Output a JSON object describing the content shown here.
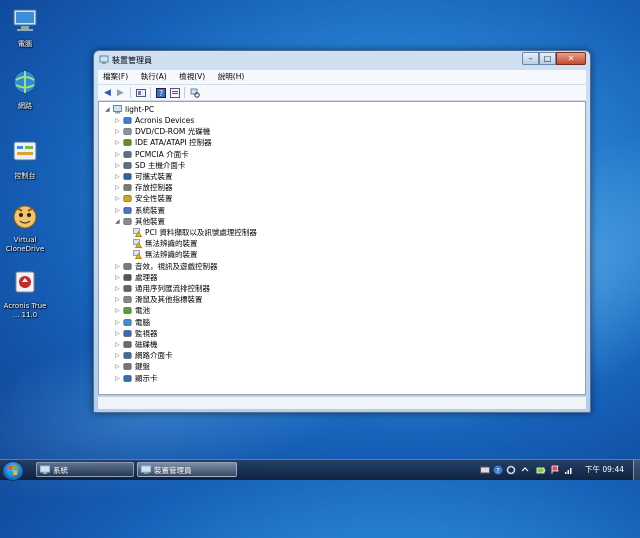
{
  "desktop": {
    "icons": [
      {
        "label": "電腦",
        "icon": "computer-icon"
      },
      {
        "label": "網路",
        "icon": "network-icon"
      },
      {
        "label": "控制台",
        "icon": "control-panel-icon"
      },
      {
        "label": "Virtual CloneDrive",
        "icon": "virtual-clonedrive-icon"
      },
      {
        "label": "Acronis True ... 11.0",
        "icon": "acronis-icon"
      }
    ]
  },
  "window": {
    "title": "裝置管理員",
    "menu": [
      "檔案(F)",
      "執行(A)",
      "檢視(V)",
      "說明(H)"
    ],
    "controls": {
      "minimize": "–",
      "maximize": "□",
      "close": "✕"
    }
  },
  "tree": {
    "root": "light-PC",
    "items": [
      {
        "label": "Acronis Devices",
        "icon": "device-icon",
        "depth": 1,
        "expanded": false
      },
      {
        "label": "DVD/CD-ROM 光碟機",
        "icon": "dvd-drive-icon",
        "depth": 1,
        "expanded": false
      },
      {
        "label": "IDE ATA/ATAPI 控制器",
        "icon": "ide-controller-icon",
        "depth": 1,
        "expanded": false
      },
      {
        "label": "PCMCIA 介面卡",
        "icon": "pcmcia-icon",
        "depth": 1,
        "expanded": false
      },
      {
        "label": "SD 主機介面卡",
        "icon": "sd-host-icon",
        "depth": 1,
        "expanded": false
      },
      {
        "label": "可攜式裝置",
        "icon": "portable-device-icon",
        "depth": 1,
        "expanded": false
      },
      {
        "label": "存放控制器",
        "icon": "storage-controller-icon",
        "depth": 1,
        "expanded": false
      },
      {
        "label": "安全性裝置",
        "icon": "security-device-icon",
        "depth": 1,
        "expanded": false
      },
      {
        "label": "系統裝置",
        "icon": "system-device-icon",
        "depth": 1,
        "expanded": false
      },
      {
        "label": "其他裝置",
        "icon": "other-devices-icon",
        "depth": 1,
        "expanded": true
      },
      {
        "label": "PCI 資料擷取以及訊號處理控制器",
        "icon": "warning-device-icon",
        "depth": 2
      },
      {
        "label": "無法辨識的裝置",
        "icon": "warning-device-icon",
        "depth": 2
      },
      {
        "label": "無法辨識的裝置",
        "icon": "warning-device-icon",
        "depth": 2
      },
      {
        "label": "音效，視訊及遊戲控制器",
        "icon": "audio-icon",
        "depth": 1,
        "expanded": false
      },
      {
        "label": "處理器",
        "icon": "processor-icon",
        "depth": 1,
        "expanded": false
      },
      {
        "label": "通用序列匯流排控制器",
        "icon": "usb-icon",
        "depth": 1,
        "expanded": false
      },
      {
        "label": "滑鼠及其他指標裝置",
        "icon": "mouse-icon",
        "depth": 1,
        "expanded": false
      },
      {
        "label": "電池",
        "icon": "battery-icon",
        "depth": 1,
        "expanded": false
      },
      {
        "label": "電腦",
        "icon": "computer-icon",
        "depth": 1,
        "expanded": false
      },
      {
        "label": "監視器",
        "icon": "monitor-icon",
        "depth": 1,
        "expanded": false
      },
      {
        "label": "磁碟機",
        "icon": "disk-drive-icon",
        "depth": 1,
        "expanded": false
      },
      {
        "label": "網路介面卡",
        "icon": "network-adapter-icon",
        "depth": 1,
        "expanded": false
      },
      {
        "label": "鍵盤",
        "icon": "keyboard-icon",
        "depth": 1,
        "expanded": false
      },
      {
        "label": "顯示卡",
        "icon": "display-adapter-icon",
        "depth": 1,
        "expanded": false
      }
    ]
  },
  "taskbar": {
    "buttons": [
      {
        "label": "系統",
        "icon": "system-icon"
      },
      {
        "label": "裝置管理員",
        "icon": "device-manager-icon"
      }
    ],
    "clock": "下午 09:44"
  },
  "colors": {
    "accent": "#2b86d6",
    "warning": "#e8b400"
  }
}
